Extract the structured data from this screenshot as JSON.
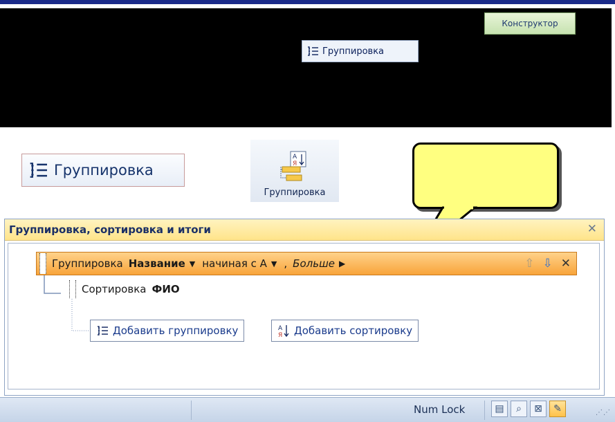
{
  "ribbon_tab": {
    "label": "Конструктор"
  },
  "group_button_small": {
    "label": "Группировка"
  },
  "group_button_large": {
    "label": "Группировка"
  },
  "group_button_big": {
    "label": "Группировка"
  },
  "panel": {
    "title": "Группировка, сортировка и итоги",
    "group_row": {
      "prefix": "Группировка",
      "field": "Название",
      "order": "начиная с А",
      "separator": ",",
      "more": "Больше"
    },
    "sort_row": {
      "prefix": "Сортировка",
      "field": "ФИО"
    },
    "add_group_label": "Добавить группировку",
    "add_sort_label": "Добавить сортировку"
  },
  "statusbar": {
    "numlock": "Num Lock"
  },
  "colors": {
    "header": "#ffe48a",
    "group_row": "#f8a43a",
    "callout": "#ffff80"
  }
}
